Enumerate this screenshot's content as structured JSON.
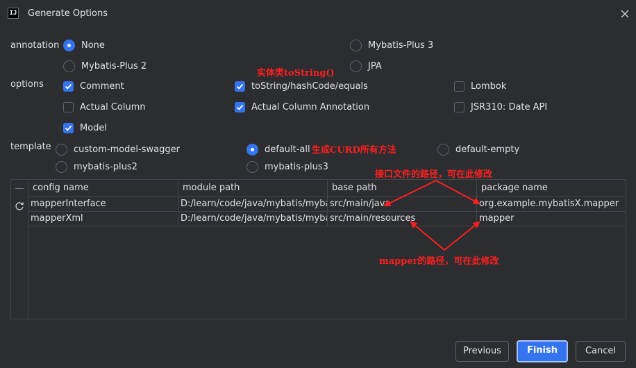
{
  "window": {
    "title": "Generate Options",
    "app_icon_text": "IJ"
  },
  "annotation": {
    "label": "annotation",
    "options": [
      {
        "label": "None",
        "selected": true
      },
      {
        "label": "Mybatis-Plus 3",
        "selected": false
      },
      {
        "label": "Mybatis-Plus 2",
        "selected": false
      },
      {
        "label": "JPA",
        "selected": false
      }
    ]
  },
  "options": {
    "label": "options",
    "items": [
      {
        "label": "Comment",
        "checked": true
      },
      {
        "label": "toString/hashCode/equals",
        "checked": true
      },
      {
        "label": "Lombok",
        "checked": false
      },
      {
        "label": "Actual Column",
        "checked": false
      },
      {
        "label": "Actual Column Annotation",
        "checked": true
      },
      {
        "label": "JSR310: Date API",
        "checked": false
      },
      {
        "label": "Model",
        "checked": true
      }
    ]
  },
  "template": {
    "label": "template",
    "options": [
      {
        "label": "custom-model-swagger",
        "selected": false
      },
      {
        "label": "default-all",
        "selected": true
      },
      {
        "label": "default-empty",
        "selected": false
      },
      {
        "label": "mybatis-plus2",
        "selected": false
      },
      {
        "label": "mybatis-plus3",
        "selected": false
      }
    ]
  },
  "table": {
    "columns": [
      "config name",
      "module path",
      "base path",
      "package name"
    ],
    "rows": [
      [
        "mapperInterface",
        "D:/learn/code/java/mybatis/mybatis",
        "src/main/java",
        "org.example.mybatisX.mapper"
      ],
      [
        "mapperXml",
        "D:/learn/code/java/mybatis/mybatis",
        "src/main/resources",
        "mapper"
      ]
    ]
  },
  "annotations_overlay": {
    "tostring_note": "实体类toString()",
    "crud_note": "生成CURD所有方法",
    "interface_path_note": "接口文件的路径，可在此修改",
    "mapper_path_note": "mapper的路径，可在此修改",
    "color": "#ff1f1f"
  },
  "buttons": {
    "previous": "Previous",
    "finish": "Finish",
    "cancel": "Cancel"
  },
  "colors": {
    "background": "#2b2d30",
    "accent": "#3574f0",
    "text": "#dfe1e5",
    "border": "#43454a"
  }
}
